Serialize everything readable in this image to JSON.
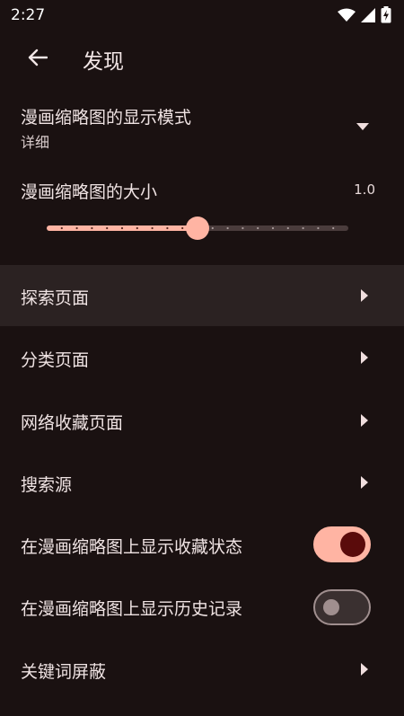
{
  "status": {
    "time": "2:27"
  },
  "appbar": {
    "title": "发现"
  },
  "display_mode": {
    "label": "漫画缩略图的显示模式",
    "value": "详细"
  },
  "thumb_size": {
    "label": "漫画缩略图的大小",
    "value": "1.0",
    "fraction": 0.5
  },
  "items": [
    {
      "label": "探索页面"
    },
    {
      "label": "分类页面"
    },
    {
      "label": "网络收藏页面"
    },
    {
      "label": "搜索源"
    }
  ],
  "toggles": [
    {
      "label": "在漫画缩略图上显示收藏状态",
      "on": true
    },
    {
      "label": "在漫画缩略图上显示历史记录",
      "on": false
    }
  ],
  "keyword_block": {
    "label": "关键词屏蔽"
  },
  "colors": {
    "accent": "#ffb4a3",
    "background": "#1a1111",
    "highlight": "#2b2222",
    "thumb_on": "#5a0b0b"
  }
}
